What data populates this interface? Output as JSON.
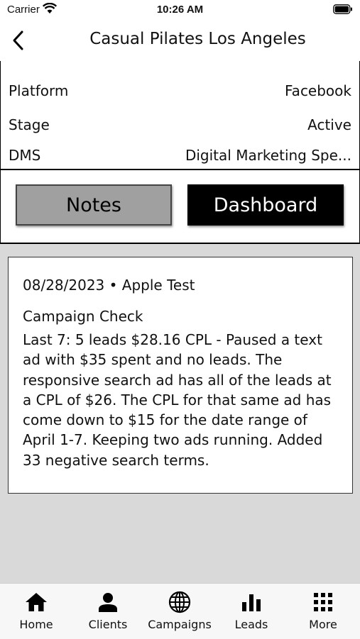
{
  "status_bar": {
    "carrier": "Carrier",
    "time": "10:26 AM"
  },
  "nav": {
    "title": "Casual Pilates Los Angeles"
  },
  "info": {
    "rows": [
      {
        "label": "Platform",
        "value": "Facebook"
      },
      {
        "label": "Stage",
        "value": "Active"
      },
      {
        "label": "DMS",
        "value": "Digital Marketing Spe..."
      }
    ]
  },
  "buttons": {
    "notes": "Notes",
    "dashboard": "Dashboard"
  },
  "note": {
    "meta": "08/28/2023 • Apple Test",
    "type": "Campaign Check",
    "body": "Last 7: 5 leads $28.16 CPL -  Paused a text ad with $35 spent and no leads. The responsive search ad has all of the leads at a CPL of $26. The CPL for that same ad has come down to $15 for the date range of April 1-7. Keeping two ads running. Added 33 negative search terms."
  },
  "tabs": [
    {
      "label": "Home",
      "icon": "home-icon"
    },
    {
      "label": "Clients",
      "icon": "person-icon"
    },
    {
      "label": "Campaigns",
      "icon": "globe-icon"
    },
    {
      "label": "Leads",
      "icon": "bar-chart-icon"
    },
    {
      "label": "More",
      "icon": "grid-icon"
    }
  ]
}
